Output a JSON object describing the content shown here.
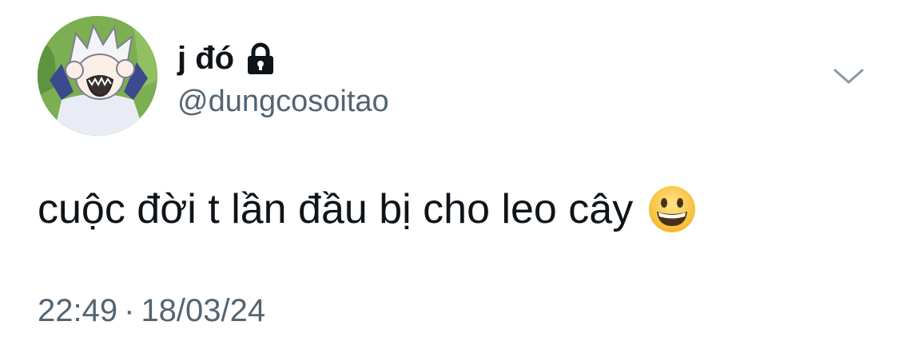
{
  "tweet": {
    "display_name": "j đó",
    "handle": "@dungcosoitao",
    "text": "cuộc đời t lần đầu bị cho leo cây",
    "emoji": "grinning-face-emoji",
    "time": "22:49",
    "separator": "·",
    "date": "18/03/24"
  },
  "icons": {
    "lock": "lock-icon",
    "menu": "chevron-down-icon",
    "avatar": "anime-character-avatar"
  },
  "colors": {
    "name": "#0f1419",
    "secondary": "#536471",
    "avatar_bg": "#7cae52"
  }
}
